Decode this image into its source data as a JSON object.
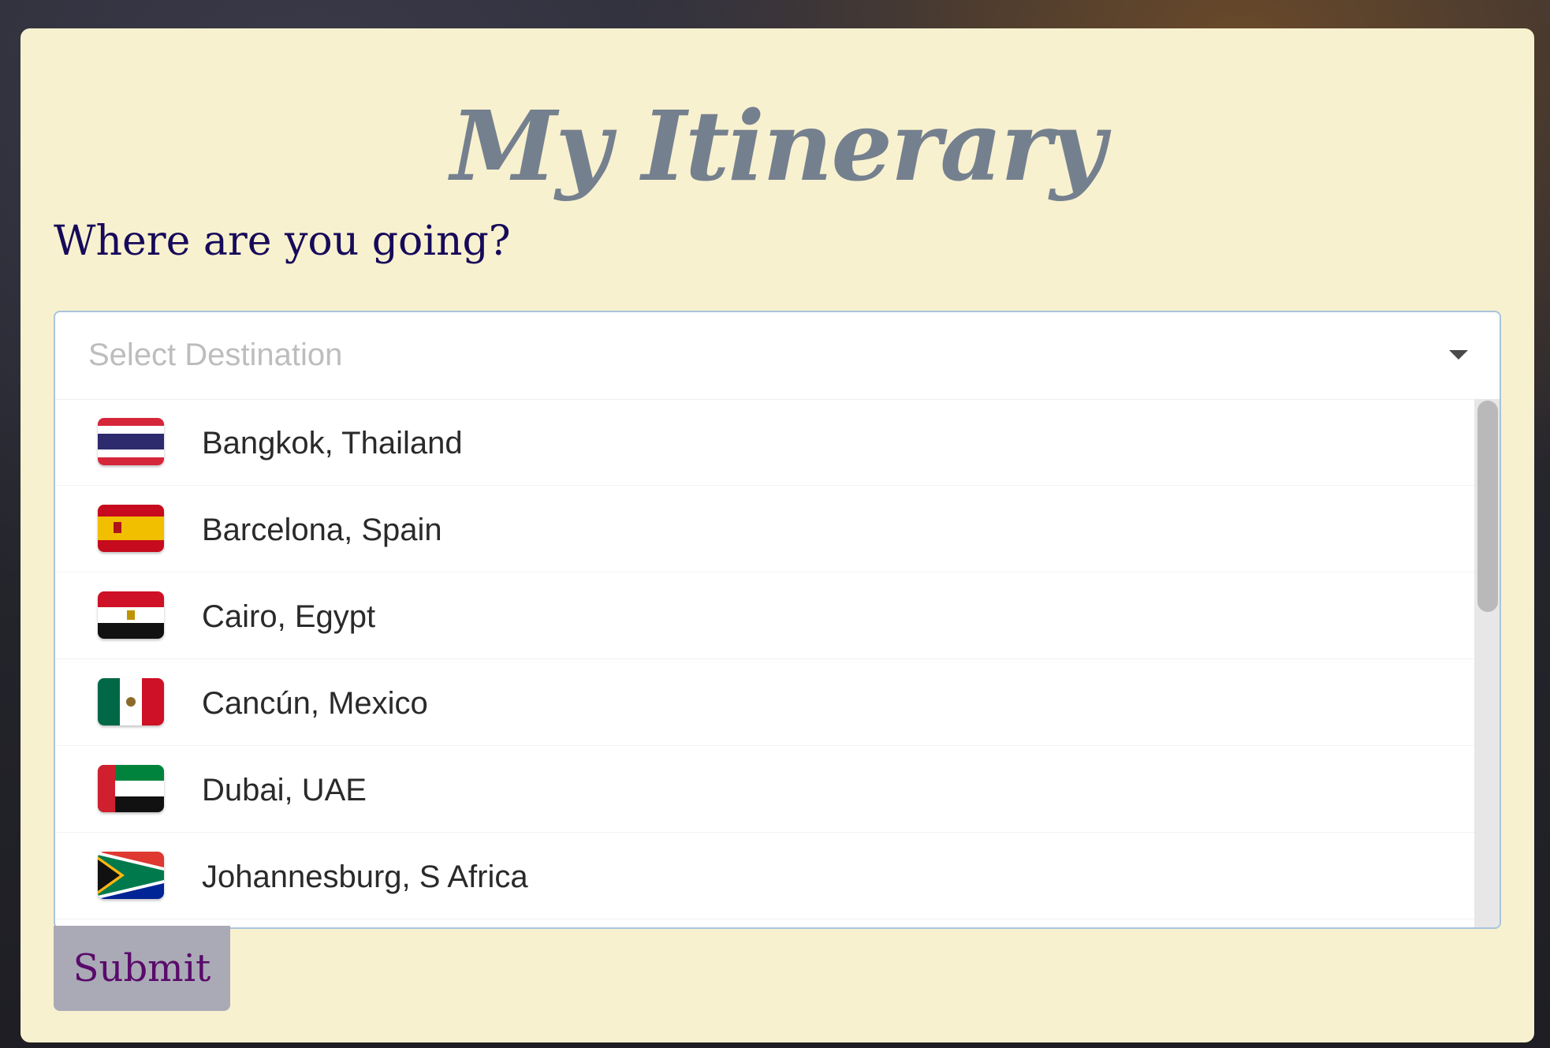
{
  "header": {
    "title": "My Itinerary"
  },
  "form": {
    "question": "Where are you going?",
    "select": {
      "placeholder": "Select Destination",
      "options": [
        {
          "label": "Bangkok, Thailand",
          "icon": "thailand-flag-icon"
        },
        {
          "label": "Barcelona, Spain",
          "icon": "spain-flag-icon"
        },
        {
          "label": "Cairo, Egypt",
          "icon": "egypt-flag-icon"
        },
        {
          "label": "Cancún, Mexico",
          "icon": "mexico-flag-icon"
        },
        {
          "label": "Dubai, UAE",
          "icon": "uae-flag-icon"
        },
        {
          "label": "Johannesburg, S Africa",
          "icon": "south-africa-flag-icon"
        }
      ]
    },
    "submit_label": "Submit"
  },
  "colors": {
    "card_background": "#f8f1cf",
    "title": "#75808f",
    "question": "#160a5a",
    "select_border": "#a9c4dc",
    "submit_background": "#a9aab6",
    "submit_text": "#5a0a6a"
  }
}
